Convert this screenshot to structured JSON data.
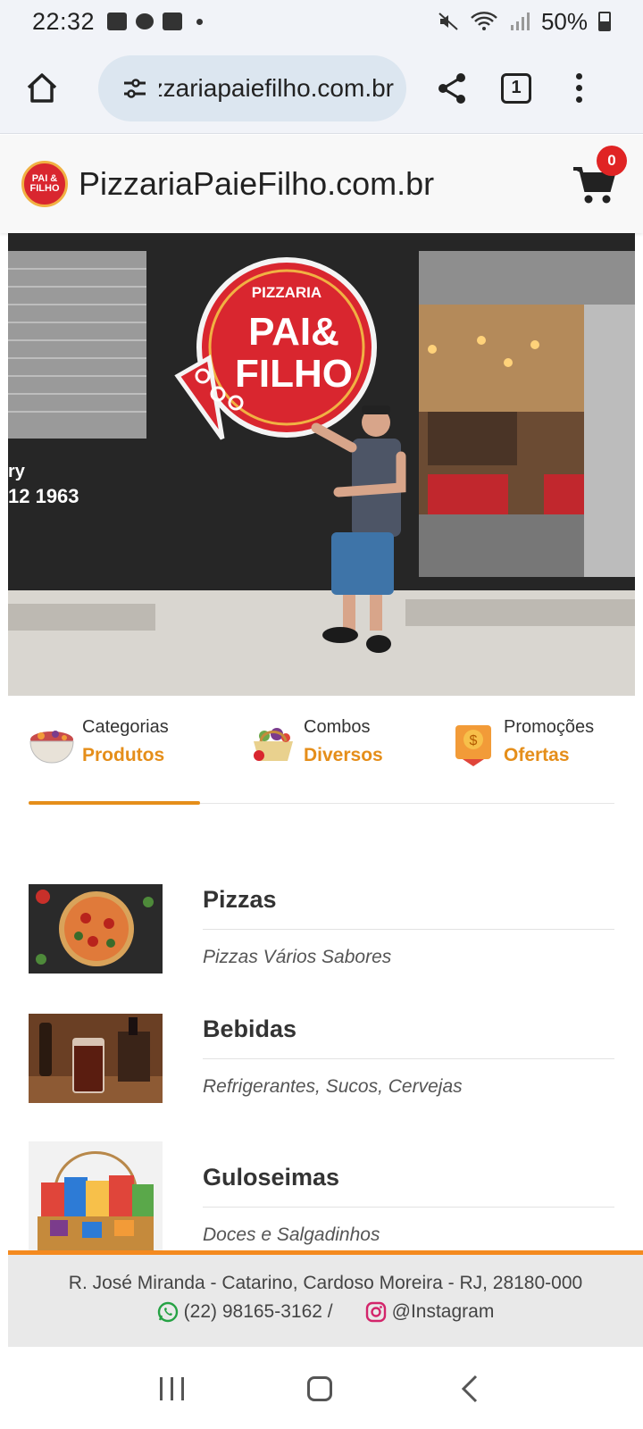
{
  "status_bar": {
    "time": "22:32",
    "battery": "50%",
    "icons": [
      "voicemail-icon",
      "message-icon",
      "alarm-icon",
      "mute-icon",
      "wifi-icon",
      "signal-icon",
      "battery-icon"
    ]
  },
  "browser": {
    "url": "pizzariapaiefilho.com.br",
    "tab_count": "1",
    "icons": [
      "home-icon",
      "site-settings-icon",
      "share-icon",
      "tabs-icon",
      "menu-icon"
    ]
  },
  "site": {
    "title": "PizzariaPaieFilho.com.br",
    "logo_text": "PAI & FILHO",
    "cart_count": "0"
  },
  "hero": {
    "sign_top": "PIZZARIA",
    "sign_line1": "PAI&",
    "sign_line2": "FILHO",
    "wall_text1": "ry",
    "wall_text2": "12 1963"
  },
  "tabs": [
    {
      "line1": "Categorias",
      "line2": "Produtos",
      "icon": "bowl-icon",
      "active": true
    },
    {
      "line1": "Combos",
      "line2": "Diversos",
      "icon": "basket-icon",
      "active": false
    },
    {
      "line1": "Promoções",
      "line2": "Ofertas",
      "icon": "price-tag-icon",
      "active": false
    }
  ],
  "categories": [
    {
      "name": "Pizzas",
      "description": "Pizzas Vários Sabores"
    },
    {
      "name": "Bebidas",
      "description": "Refrigerantes, Sucos, Cervejas"
    },
    {
      "name": "Guloseimas",
      "description": "Doces e Salgadinhos"
    }
  ],
  "footer": {
    "address": "R. José Miranda - Catarino, Cardoso Moreira - RJ, 28180-000",
    "phone": "(22) 98165-3162 /",
    "instagram": "@Instagram"
  },
  "colors": {
    "accent": "#e58e1a",
    "footer_border": "#f48a1f",
    "badge": "#e02424",
    "brand_red": "#d9262f"
  }
}
